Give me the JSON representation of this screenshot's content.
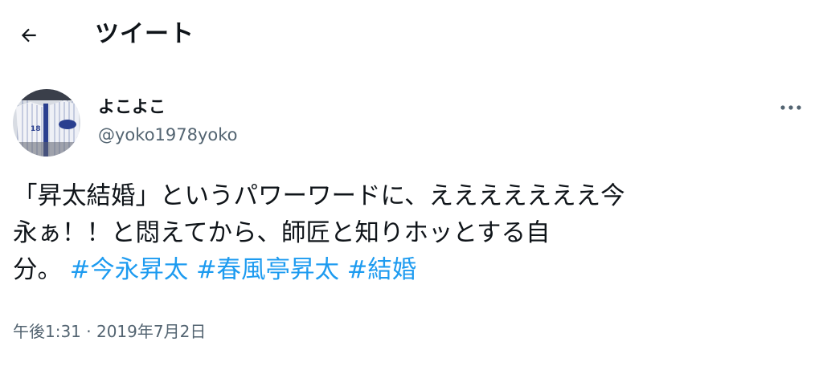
{
  "header": {
    "back_icon": "arrow-left-icon",
    "title": "ツイート"
  },
  "tweet": {
    "author": {
      "display_name": "よこよこ",
      "handle": "@yoko1978yoko"
    },
    "more_icon": "more-horizontal-icon",
    "text_lines": [
      "「昇太結婚」というパワーワードに、えええええええ今",
      "永ぁ！！と悶えてから、師匠と知りホッとする自",
      "分。"
    ],
    "hashtags": [
      "#今永昇太",
      "#春風亭昇太",
      "#結婚"
    ],
    "timestamp": "午後1:31 · 2019年7月2日"
  },
  "colors": {
    "text": "#0f1419",
    "secondary": "#536471",
    "link": "#1d9bf0"
  }
}
